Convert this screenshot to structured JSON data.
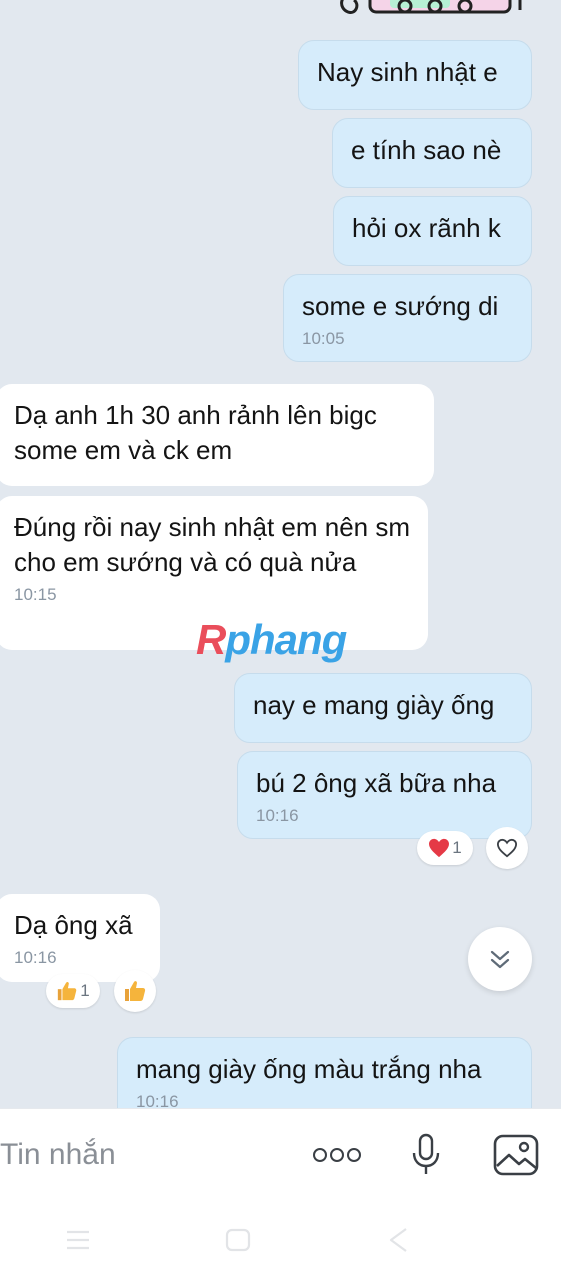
{
  "messages": [
    {
      "direction": "out",
      "text": "Nay sinh nhật e",
      "time": ""
    },
    {
      "direction": "out",
      "text": "e tính sao nè",
      "time": ""
    },
    {
      "direction": "out",
      "text": "hỏi ox rãnh k",
      "time": ""
    },
    {
      "direction": "out",
      "text": "some e sướng di",
      "time": "10:05"
    },
    {
      "direction": "in",
      "text": "Dạ anh 1h 30 anh rảnh lên bigc some em và ck em",
      "time": ""
    },
    {
      "direction": "in",
      "text": "Đúng rồi nay sinh nhật em nên sm cho em sướng và có quà nửa",
      "time": "10:15"
    },
    {
      "direction": "out",
      "text": "nay e mang giày ống",
      "time": ""
    },
    {
      "direction": "out",
      "text": "bú 2 ông xã bữa nha",
      "time": "10:16",
      "reaction_icon": "red-heart-icon",
      "reaction_count": "1"
    },
    {
      "direction": "in",
      "text": "Dạ ông xã",
      "time": "10:16",
      "reaction_icon": "thumbs-up-icon",
      "reaction_count": "1"
    },
    {
      "direction": "out",
      "text": "mang giày ống màu trắng nha",
      "time": "10:16"
    }
  ],
  "watermark": {
    "first": "R",
    "rest": "phang"
  },
  "composer": {
    "placeholder": "Tin nhắn"
  },
  "colors": {
    "background": "#e2e8ef",
    "outgoing_bubble": "#d6ecfb",
    "incoming_bubble": "#ffffff",
    "timestamp": "#8a96a3",
    "heart": "#e53946",
    "thumbs": "#f5b43c"
  }
}
